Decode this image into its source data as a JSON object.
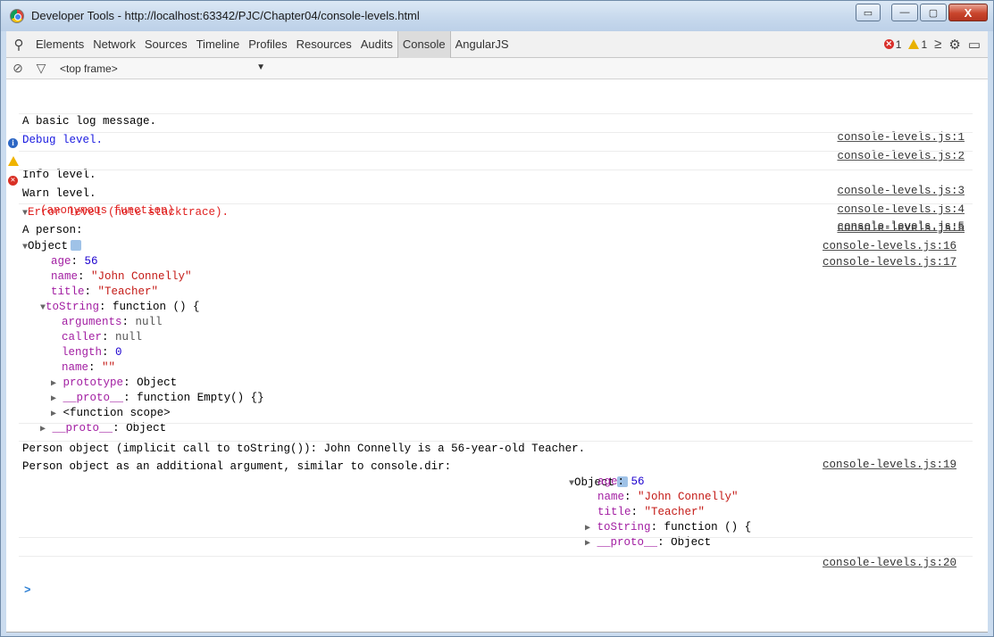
{
  "window": {
    "title": "Developer Tools - http://localhost:63342/PJC/Chapter04/console-levels.html",
    "minimize_glyph": "—",
    "maximize_glyph": "▢",
    "close_glyph": "X",
    "extra_glyph": "▭"
  },
  "toolbar": {
    "search_icon": "search-icon",
    "tabs": [
      "Elements",
      "Network",
      "Sources",
      "Timeline",
      "Profiles",
      "Resources",
      "Audits",
      "Console",
      "AngularJS"
    ],
    "selected_tab": "Console",
    "error_count": "1",
    "warning_count": "1"
  },
  "filterbar": {
    "frame": "<top frame>"
  },
  "console": {
    "lines": [
      {
        "text": "A basic log message.",
        "src": "console-levels.js:1"
      },
      {
        "text": "Debug level.",
        "src": "console-levels.js:2"
      },
      {
        "text": "Info level.",
        "src": "console-levels.js:3"
      },
      {
        "text": "Warn level.",
        "src": "console-levels.js:4"
      },
      {
        "text": "Error level (note stacktrace).",
        "src": "console-levels.js:5"
      },
      {
        "text": "(anonymous function)",
        "src": "console-levels.js:5"
      },
      {
        "text": "A person:",
        "src": "console-levels.js:16"
      },
      {
        "text": "Object",
        "src": "console-levels.js:17"
      }
    ],
    "object1": {
      "age_key": "age",
      "age_val": "56",
      "name_key": "name",
      "name_val": "\"John Connelly\"",
      "title_key": "title",
      "title_val": "\"Teacher\"",
      "tostring_key": "toString",
      "tostring_val": "function () {",
      "arguments_key": "arguments",
      "arguments_val": "null",
      "caller_key": "caller",
      "caller_val": "null",
      "length_key": "length",
      "length_val": "0",
      "fname_key": "name",
      "fname_val": "\"\"",
      "prototype_key": "prototype",
      "prototype_val": "Object",
      "proto1_key": "__proto__",
      "proto1_val": "function Empty() {}",
      "scope": "<function scope>",
      "proto2_key": "__proto__",
      "proto2_val": "Object"
    },
    "tostring_line": {
      "text": "Person object (implicit call to toString()): John Connelly is a 56-year-old Teacher.",
      "src": "console-levels.js:19"
    },
    "dir_line": {
      "text": "Person object as an additional argument, similar to console.dir:",
      "src": "console-levels.js:20"
    },
    "object2": {
      "label": "Object",
      "age_key": "age",
      "age_val": "56",
      "name_key": "name",
      "name_val": "\"John Connelly\"",
      "title_key": "title",
      "title_val": "\"Teacher\"",
      "tostring_key": "toString",
      "tostring_val": "function () {",
      "proto_key": "__proto__",
      "proto_val": "Object"
    },
    "prompt": ">"
  }
}
